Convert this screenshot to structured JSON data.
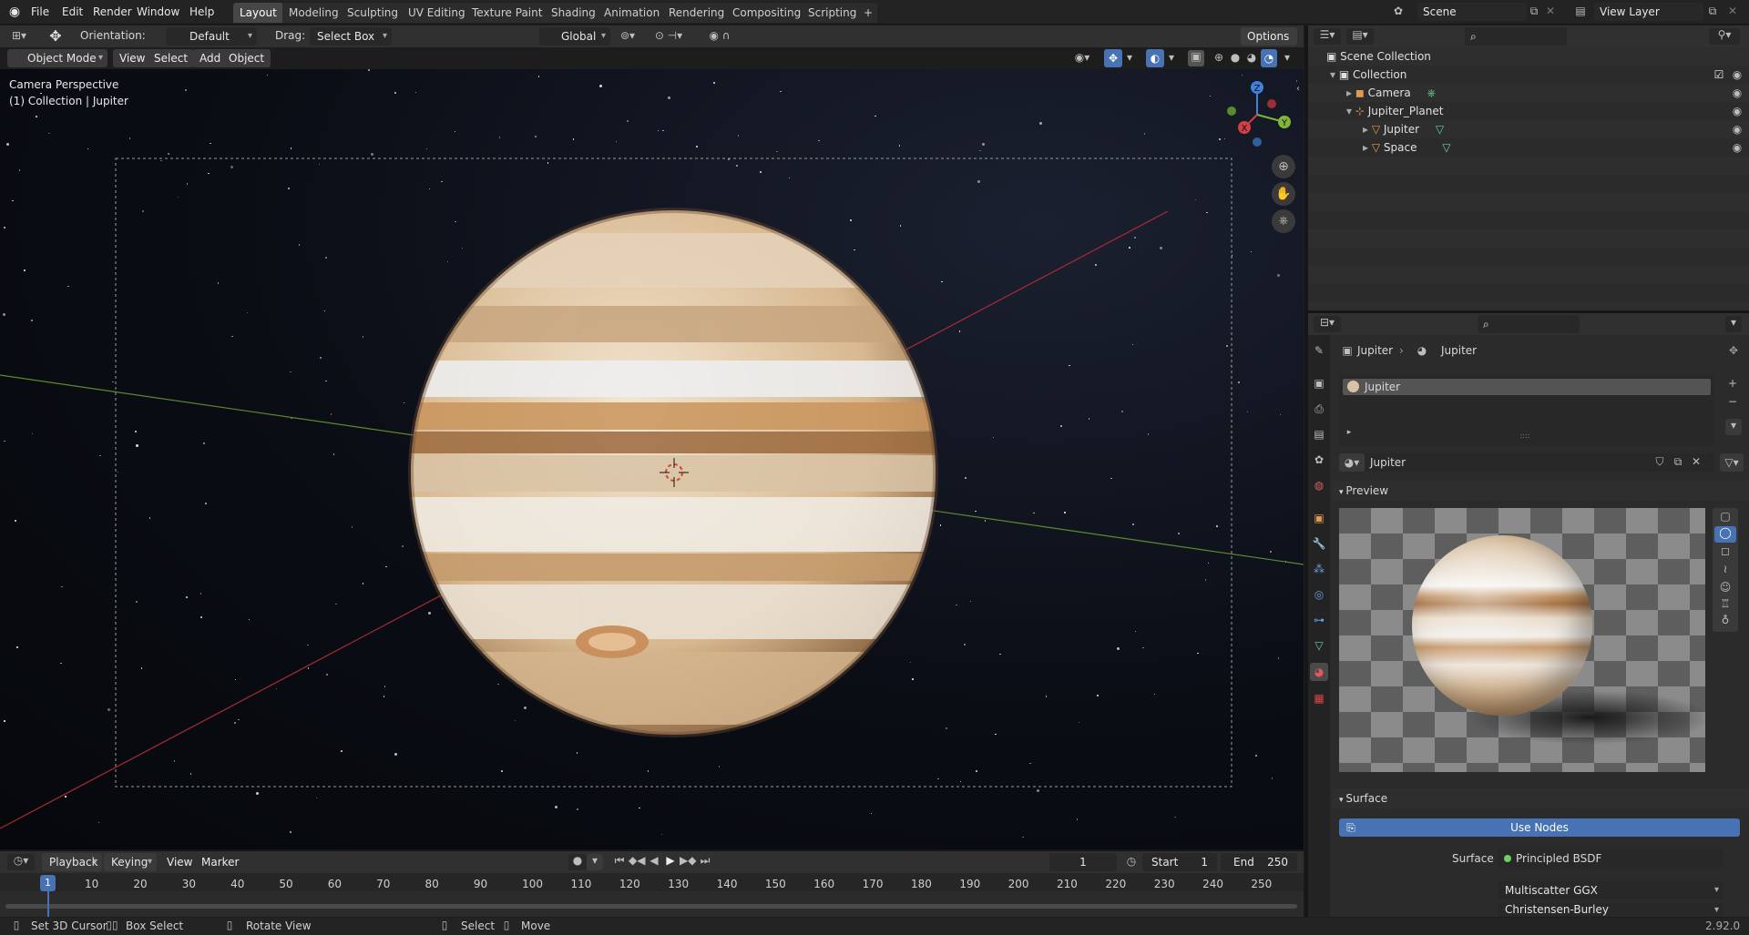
{
  "menu": [
    "File",
    "Edit",
    "Render",
    "Window",
    "Help"
  ],
  "workspaces": [
    "Layout",
    "Modeling",
    "Sculpting",
    "UV Editing",
    "Texture Paint",
    "Shading",
    "Animation",
    "Rendering",
    "Compositing",
    "Scripting"
  ],
  "active_workspace": "Layout",
  "add_workspace": "+",
  "scene": {
    "name": "Scene",
    "view_layer": "View Layer"
  },
  "tool_header": {
    "orientation_label": "Orientation:",
    "orientation_value": "Default",
    "drag_label": "Drag:",
    "drag_value": "Select Box",
    "transform_orientation": "Global",
    "options": "Options"
  },
  "viewport_header": {
    "mode": "Object Mode",
    "view": "View",
    "select": "Select",
    "add": "Add",
    "object": "Object"
  },
  "viewport": {
    "perspective": "Camera Perspective",
    "context": "(1) Collection | Jupiter"
  },
  "gizmo": {
    "x": "X",
    "y": "Y",
    "z": "Z"
  },
  "outliner": {
    "scene_collection": "Scene Collection",
    "items": [
      {
        "label": "Collection"
      },
      {
        "label": "Camera"
      },
      {
        "label": "Jupiter_Planet"
      },
      {
        "label": "Jupiter"
      },
      {
        "label": "Space"
      }
    ]
  },
  "properties": {
    "breadcrumb_object": "Jupiter",
    "breadcrumb_material": "Jupiter",
    "slot": "Jupiter",
    "material_name": "Jupiter",
    "preview_header": "Preview",
    "surface_header": "Surface",
    "use_nodes": "Use Nodes",
    "surface_label": "Surface",
    "surface_value": "Principled BSDF",
    "distribution": "Multiscatter GGX",
    "subsurface_method": "Christensen-Burley"
  },
  "timeline": {
    "playback": "Playback",
    "keying": "Keying",
    "view": "View",
    "marker": "Marker",
    "current_frame": "1",
    "start_label": "Start",
    "start": "1",
    "end_label": "End",
    "end": "250",
    "ruler": [
      "1",
      "10",
      "20",
      "30",
      "40",
      "50",
      "60",
      "70",
      "80",
      "90",
      "100",
      "110",
      "120",
      "130",
      "140",
      "150",
      "160",
      "170",
      "180",
      "190",
      "200",
      "210",
      "220",
      "230",
      "240",
      "250"
    ]
  },
  "status": {
    "set_cursor": "Set 3D Cursor",
    "box_select": "Box Select",
    "rotate_view": "Rotate View",
    "select": "Select",
    "move": "Move",
    "version": "2.92.0"
  },
  "colors": {
    "accent": "#4772b3",
    "active_tab": "#474747",
    "axis_x": "#d23f45",
    "axis_y": "#7fb53b",
    "axis_z": "#3f82dc"
  }
}
